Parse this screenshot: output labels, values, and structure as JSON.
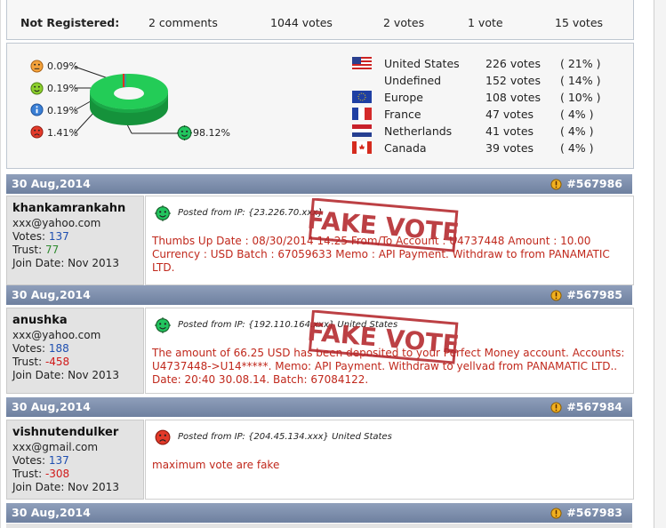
{
  "stats": {
    "label": "Not Registered:",
    "comments": "2 comments",
    "votes_total": "1044 votes",
    "votes_a": "2 votes",
    "votes_b": "1 vote",
    "votes_c": "15 votes"
  },
  "vote_chart": {
    "type": "pie",
    "slices": [
      {
        "label": "0.09%",
        "value": 0.09,
        "icon": "neutral-face-icon",
        "color": "#f0a020"
      },
      {
        "label": "0.19%",
        "value": 0.19,
        "icon": "happy-face-icon",
        "color": "#7cc020"
      },
      {
        "label": "0.19%",
        "value": 0.19,
        "icon": "info-icon",
        "color": "#3a7fd5"
      },
      {
        "label": "1.41%",
        "value": 1.41,
        "icon": "sad-face-icon",
        "color": "#e03020"
      },
      {
        "label": "98.12%",
        "value": 98.12,
        "icon": "thumbs-up-face-icon",
        "color": "#22c55e"
      }
    ]
  },
  "countries": [
    {
      "name": "United States",
      "votes": "226 votes",
      "pct": "( 21% )",
      "flag": "us-flag-icon"
    },
    {
      "name": "Undefined",
      "votes": "152 votes",
      "pct": "( 14% )",
      "flag": ""
    },
    {
      "name": "Europe",
      "votes": "108 votes",
      "pct": "( 10% )",
      "flag": "eu-flag-icon"
    },
    {
      "name": "France",
      "votes": "47 votes",
      "pct": "( 4% )",
      "flag": "france-flag-icon"
    },
    {
      "name": "Netherlands",
      "votes": "41 votes",
      "pct": "( 4% )",
      "flag": "netherlands-flag-icon"
    },
    {
      "name": "Canada",
      "votes": "39 votes",
      "pct": "( 4% )",
      "flag": "canada-flag-icon"
    }
  ],
  "posts": [
    {
      "date": "30 Aug,2014",
      "number": "#567986",
      "username": "khankamrankahn",
      "email": "xxx@yahoo.com",
      "votes_label": "Votes:",
      "votes": "137",
      "trust_label": "Trust:",
      "trust": "77",
      "join": "Join Date: Nov 2013",
      "posted": "Posted from IP: {23.226.70.xxx}",
      "message": "Thumbs Up Date : 08/30/2014 14:25 From/To Account : U4737448 Amount : 10.00 Currency : USD Batch : 67059633 Memo : API Payment. Withdraw to from PANAMATIC LTD.",
      "stamp": "FAKE VOTE"
    },
    {
      "date": "30 Aug,2014",
      "number": "#567985",
      "username": "anushka",
      "email": "xxx@yahoo.com",
      "votes_label": "Votes:",
      "votes": "188",
      "trust_label": "Trust:",
      "trust": "-458",
      "join": "Join Date: Nov 2013",
      "posted": "Posted from IP: {192.110.164.xxx} United States",
      "message": "The amount of 66.25 USD has been deposited to your Perfect Money account. Accounts: U4737448->U14*****. Memo: API Payment. Withdraw to yellvad from PANAMATIC LTD.. Date: 20:40 30.08.14. Batch: 67084122.",
      "stamp": "FAKE VOTE"
    },
    {
      "date": "30 Aug,2014",
      "number": "#567984",
      "username": "vishnutendulker",
      "email": "xxx@gmail.com",
      "votes_label": "Votes:",
      "votes": "137",
      "trust_label": "Trust:",
      "trust": "-308",
      "join": "Join Date: Nov 2013",
      "posted": "Posted from IP: {204.45.134.xxx} United States",
      "message": "maximum vote are fake"
    },
    {
      "date": "30 Aug,2014",
      "number": "#567983"
    }
  ]
}
